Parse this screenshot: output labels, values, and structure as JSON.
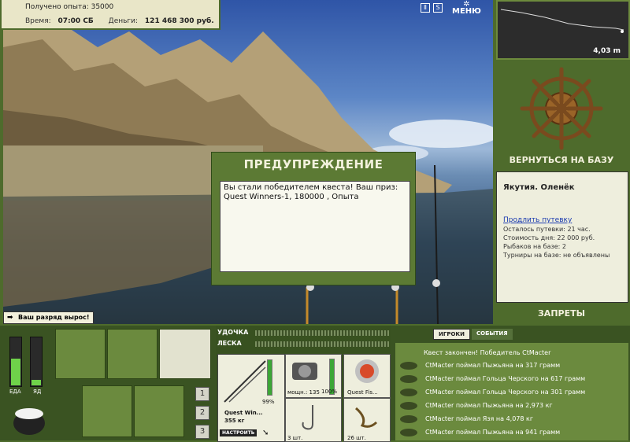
{
  "hud": {
    "exp_text": "Получено опыта: 35000",
    "time_label": "Время:",
    "time_value": "07:00 СБ",
    "money_label": "Деньги:",
    "money_value": "121 468 300 руб.",
    "menu_label": "МЕНЮ",
    "pause_icon": "pause-icon",
    "sound_label": "S"
  },
  "depth": {
    "value": "4,03 m"
  },
  "dialog": {
    "title": "ПРЕДУПРЕЖДЕНИЕ",
    "message": "Вы стали победителем квеста! Ваш приз: Quest Winners-1, 180000 , Опыта"
  },
  "level_up": {
    "text": "Ваш разряд вырос!"
  },
  "right": {
    "return_label": "ВЕРНУТЬСЯ НА БАЗУ",
    "location": "Якутия. Оленёк",
    "extend_link": "Продлить путевку",
    "lines": [
      "Осталось путевки: 21 час.",
      "Стоимость дня: 22 000 руб.",
      "Рыбаков на базе: 2",
      "Турниры на базе: не объявлены"
    ],
    "bans_label": "ЗАПРЕТЫ"
  },
  "bottom": {
    "meters": [
      {
        "label": "ЕДА",
        "level": 0.55
      },
      {
        "label": "ЯД",
        "level": 0.12
      }
    ],
    "numbers": [
      "1",
      "2",
      "3"
    ]
  },
  "tackle": {
    "rod_label": "УДОЧКА",
    "line_label": "ЛЕСКА",
    "rod_name": "Quest Win...",
    "rod_weight": "355 кг",
    "rod_pct": "99%",
    "rod_level": 0.99,
    "reel_pct": "100%",
    "reel_power": "мощн.: 135",
    "reel_level": 1.0,
    "lure_name": "Quest Fis...",
    "hook_label": "3 шт.",
    "bait_label": "26 шт.",
    "tune_label": "НАСТРОИТЬ"
  },
  "events": {
    "tabs": [
      "ИГРОКИ",
      "СОБЫТИЯ"
    ],
    "header": "Квест закончен! Победитель CtMacter",
    "rows": [
      "CtMacter поймал Пыжьяна на 317 грамм",
      "CtMacter поймал Гольца Черского на 617 грамм",
      "CtMacter поймал Гольца Черского на 301 грамм",
      "CtMacter поймал Пыжьяна на 2,973 кг",
      "CtMacter поймал Язя на 4,078 кг",
      "CtMacter поймал Пыжьяна на 941 грамм"
    ]
  }
}
